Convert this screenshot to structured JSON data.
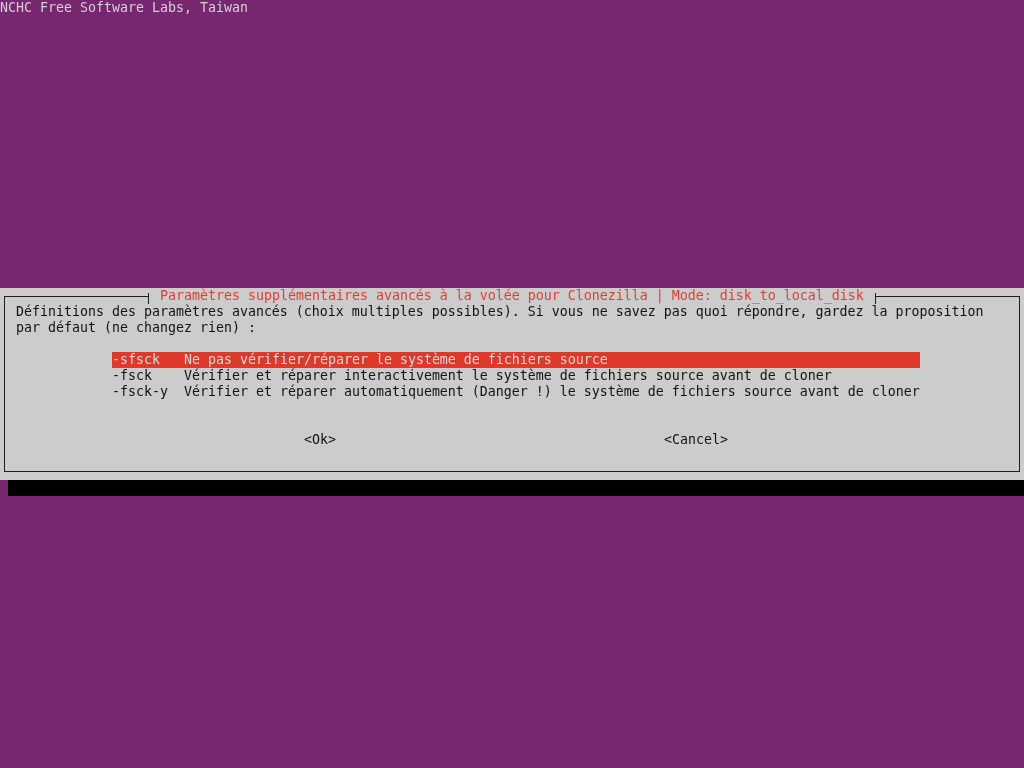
{
  "header": {
    "text": "NCHC Free Software Labs, Taiwan"
  },
  "dialog": {
    "title": "Paramètres supplémentaires avancés à la volée pour Clonezilla | Mode: disk_to_local_disk",
    "prompt": "Définitions des paramètres avancés (choix multiples possibles). Si vous ne savez pas quoi répondre, gardez la proposition par défaut (ne changez rien) :",
    "items": [
      {
        "tag": "-sfsck",
        "description": "Ne pas vérifier/réparer le système de fichiers source",
        "selected": true
      },
      {
        "tag": "-fsck",
        "description": "Vérifier et réparer interactivement le système de fichiers source avant de cloner",
        "selected": false
      },
      {
        "tag": "-fsck-y",
        "description": "Vérifier et réparer automatiquement (Danger !) le système de fichiers source avant de cloner",
        "selected": false
      }
    ],
    "buttons": [
      "<Ok>",
      "<Cancel>"
    ]
  }
}
